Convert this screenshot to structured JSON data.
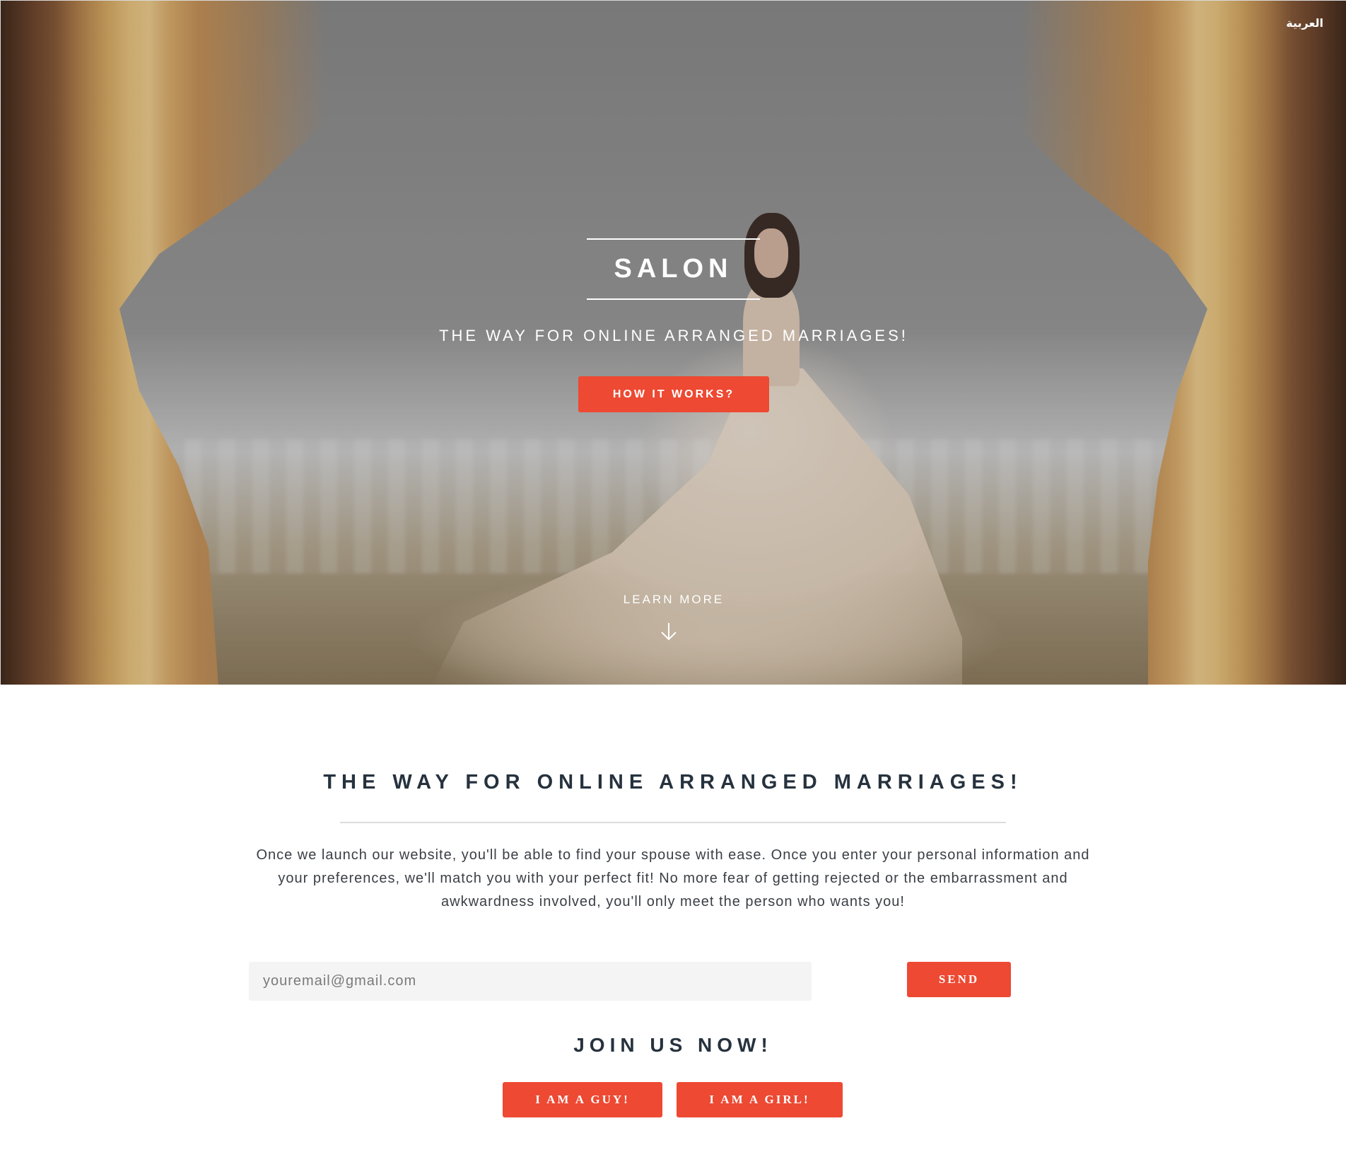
{
  "header": {
    "language_link": "العربية"
  },
  "hero": {
    "brand": "SALON",
    "tagline": "THE WAY FOR ONLINE ARRANGED MARRIAGES!",
    "cta_label": "HOW IT WORKS?",
    "learn_more": "LEARN MORE",
    "scroll_icon": "arrow-down-icon"
  },
  "intro": {
    "title": "THE WAY FOR ONLINE ARRANGED MARRIAGES!",
    "body": "Once we launch our website, you'll be able to find your spouse with ease. Once you enter your personal information and your preferences, we'll match you with your perfect fit! No more fear of getting rejected or the embarrassment and awkwardness involved, you'll only meet the person who wants you!"
  },
  "signup": {
    "email_placeholder": "youremail@gmail.com",
    "email_value": "",
    "send_label": "SEND"
  },
  "join": {
    "title": "JOIN US NOW!",
    "guy_label": "I AM A GUY!",
    "girl_label": "I AM A GIRL!"
  },
  "colors": {
    "accent": "#ed4933",
    "heading": "#26323e",
    "input_bg": "#f4f4f4"
  }
}
